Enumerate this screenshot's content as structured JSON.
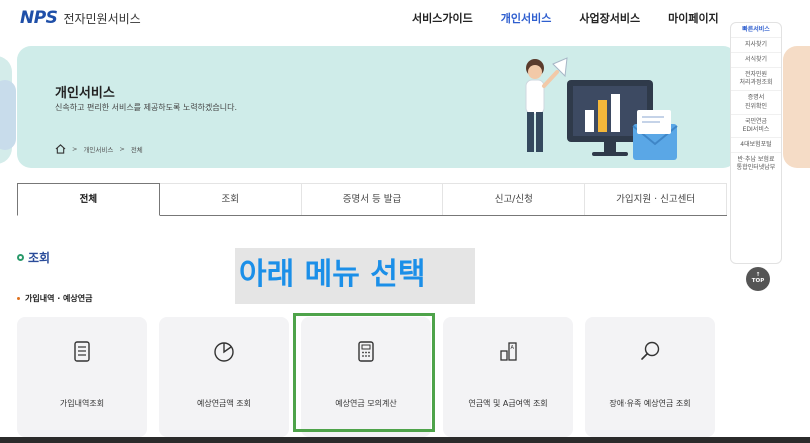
{
  "header": {
    "logo_mark": "NPS",
    "logo_text": "전자민원서비스",
    "nav": [
      "서비스가이드",
      "개인서비스",
      "사업장서비스",
      "마이페이지"
    ],
    "nav_active_index": 1
  },
  "banner": {
    "title": "개인서비스",
    "subtitle": "신속하고 편리한 서비스를 제공하도록 노력하겠습니다.",
    "breadcrumb": [
      "개인서비스",
      "전체"
    ]
  },
  "quick_menu": {
    "items": [
      "빠른서비스",
      "지사찾기",
      "서식찾기",
      "전자민원\n처리과정조회",
      "증명서\n진위확인",
      "국민연금\nEDI서비스",
      "4대보험포털",
      "반·추납 보험료\n통합인터넷납부"
    ],
    "top_label": "TOP"
  },
  "tabs": [
    "전체",
    "조회",
    "증명서 등 발급",
    "신고/신청",
    "가입지원 · 신고센터"
  ],
  "tab_active_index": 0,
  "section": {
    "title": "조회",
    "subtitle": "가입내역 · 예상연금"
  },
  "overlay_text": "아래 메뉴 선택",
  "cards": [
    {
      "label": "가입내역조회",
      "icon": "document-list-icon"
    },
    {
      "label": "예상연금액 조회",
      "icon": "pie-chart-icon"
    },
    {
      "label": "예상연금 모의계산",
      "icon": "calculator-icon"
    },
    {
      "label": "연금액 및 A급여액 조회",
      "icon": "bar-chart-icon"
    },
    {
      "label": "장애·유족 예상연금 조회",
      "icon": "magnifier-icon"
    }
  ],
  "highlighted_card_index": 2,
  "colors": {
    "brand_blue": "#1f4fa8",
    "nav_active": "#2f5fcf",
    "banner_bg": "#cfece9",
    "overlay_text": "#1b8fe8",
    "highlight": "#4ea34a"
  }
}
